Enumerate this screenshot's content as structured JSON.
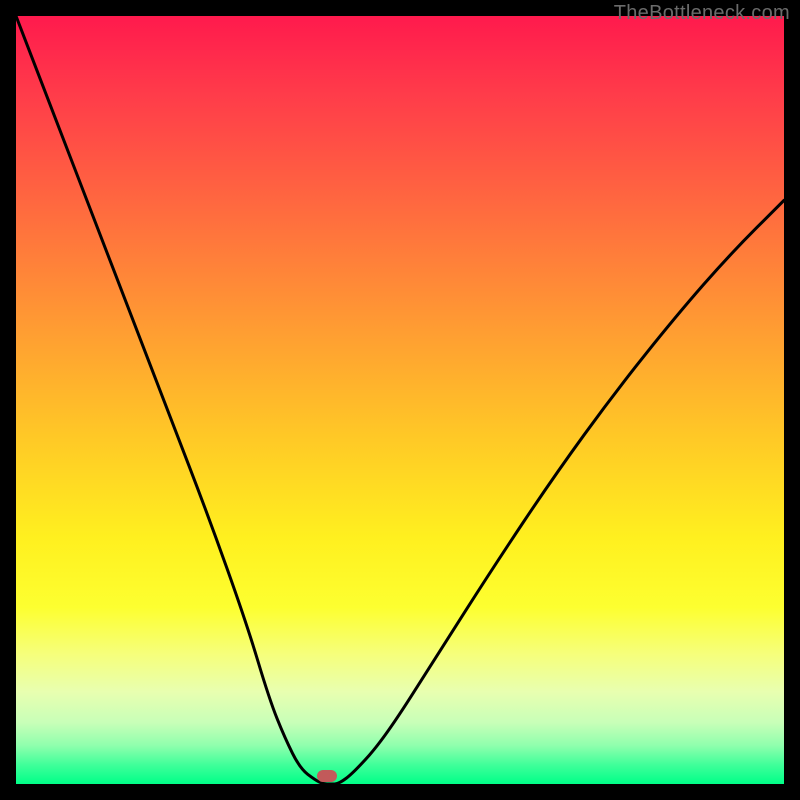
{
  "watermark": "TheBottleneck.com",
  "chart_data": {
    "type": "line",
    "title": "",
    "xlabel": "",
    "ylabel": "",
    "xlim": [
      0,
      100
    ],
    "ylim": [
      0,
      100
    ],
    "series": [
      {
        "name": "curve",
        "x": [
          0,
          5,
          10,
          15,
          20,
          25,
          30,
          33,
          35,
          37,
          39,
          40,
          41,
          42,
          44,
          48,
          55,
          62,
          70,
          78,
          86,
          93,
          100
        ],
        "y": [
          100,
          87,
          74,
          61,
          48,
          35,
          21,
          11,
          6,
          2,
          0.5,
          0,
          0,
          0,
          1.5,
          6,
          17,
          28,
          40,
          51,
          61,
          69,
          76
        ]
      }
    ],
    "marker": {
      "x": 40.5,
      "y": 1.0,
      "color": "#c25a5a"
    },
    "background_gradient": [
      "#ff1a4d",
      "#ff9a33",
      "#fff01f",
      "#00ff88"
    ]
  }
}
